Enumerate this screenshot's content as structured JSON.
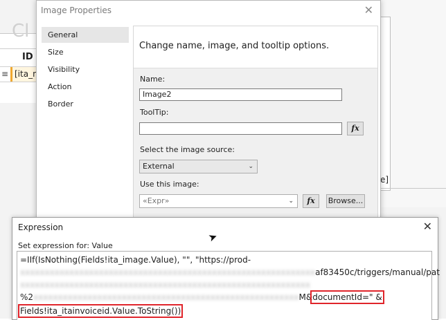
{
  "background": {
    "designer_big_text": "Cl",
    "table_header_id": "ID",
    "row_handle": "≡",
    "cell_text": "[ita_na",
    "right_bracket": "e]"
  },
  "image_properties": {
    "title": "Image Properties",
    "nav": [
      "General",
      "Size",
      "Visibility",
      "Action",
      "Border"
    ],
    "active_nav": "General",
    "heading": "Change name, image, and tooltip options.",
    "name_label": "Name:",
    "name_value": "Image2",
    "tooltip_label": "ToolTip:",
    "tooltip_value": "",
    "source_label": "Select the image source:",
    "source_value": "External",
    "use_image_label": "Use this image:",
    "use_image_value": "«Expr»",
    "fx_label": "fx",
    "browse_label": "Browse..."
  },
  "expression": {
    "title": "Expression",
    "subtitle": "Set expression for: Value",
    "line1": "=IIf(IsNothing(Fields!ita_image.Value), \"\", \"https://prod-",
    "line2_visible": "af83450c/triggers/manual/pat",
    "line4_prefix": "%2",
    "line4_visible": "M&",
    "highlight1": "documentId=\" &",
    "highlight2": "Fields!ita_itainvoiceid.Value.ToString())"
  },
  "icons": {
    "close": "✕",
    "dropdown": "⌄"
  }
}
